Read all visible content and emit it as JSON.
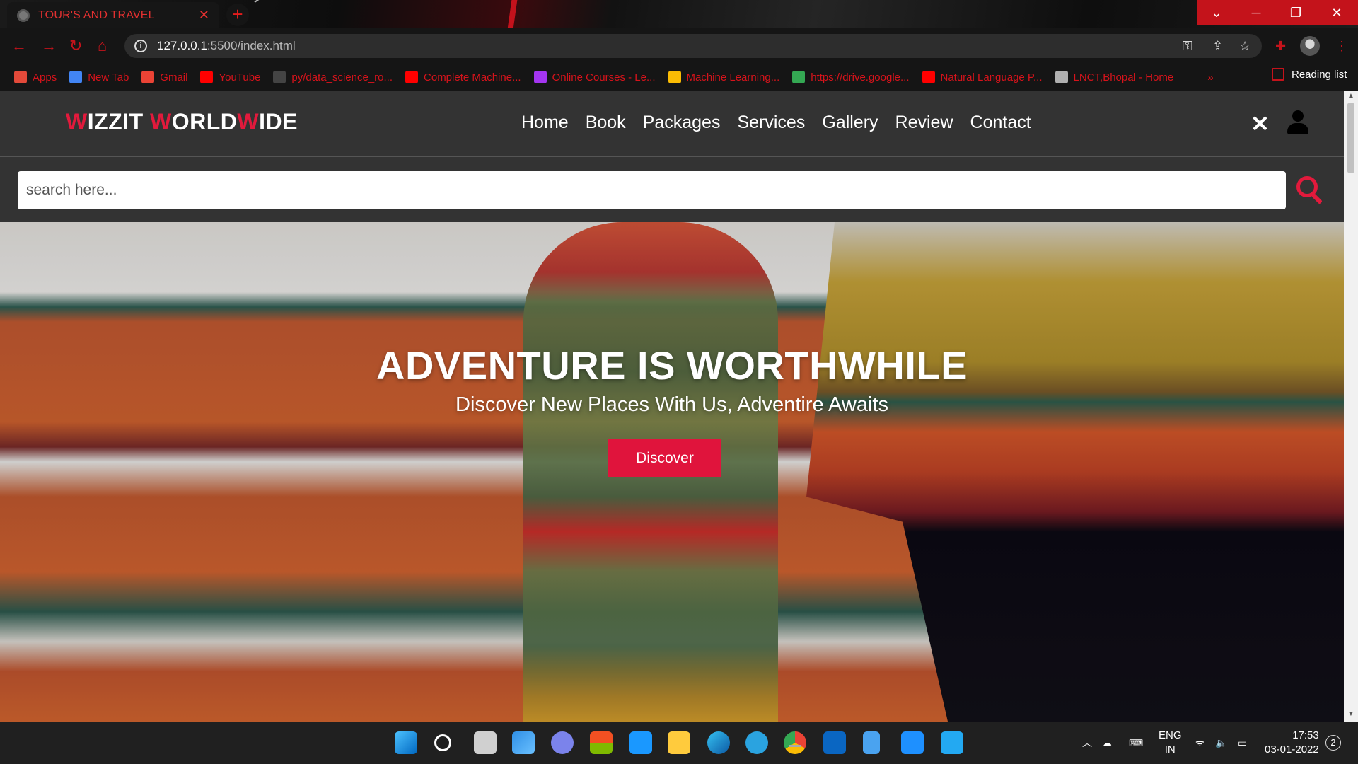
{
  "browser": {
    "tab_title": "TOUR'S AND TRAVEL",
    "tab_close": "✕",
    "new_tab": "+",
    "url_host": "127.0.0.1",
    "url_path": ":5500/index.html",
    "bookmarks": [
      {
        "label": "Apps",
        "icon": "apps-grid-icon",
        "color": "#e34a3a"
      },
      {
        "label": "New Tab",
        "icon": "google-icon",
        "color": "#4285f4"
      },
      {
        "label": "Gmail",
        "icon": "gmail-icon",
        "color": "#ea4335"
      },
      {
        "label": "YouTube",
        "icon": "youtube-icon",
        "color": "#ff0000"
      },
      {
        "label": "py/data_science_ro...",
        "icon": "github-icon",
        "color": "#444444"
      },
      {
        "label": "Complete Machine...",
        "icon": "youtube-icon",
        "color": "#ff0000"
      },
      {
        "label": "Online Courses - Le...",
        "icon": "udemy-icon",
        "color": "#a435f0"
      },
      {
        "label": "Machine Learning...",
        "icon": "drive-icon",
        "color": "#fbbc04"
      },
      {
        "label": "https://drive.google...",
        "icon": "drive-icon",
        "color": "#34a853"
      },
      {
        "label": "Natural Language P...",
        "icon": "youtube-icon",
        "color": "#ff0000"
      },
      {
        "label": "LNCT,Bhopal - Home",
        "icon": "lnct-icon",
        "color": "#b0b0b0"
      }
    ],
    "more_bookmarks": "»",
    "reading_list": "Reading list"
  },
  "site": {
    "logo": {
      "w1": "W",
      "rest1": "IZZIT ",
      "w2": "W",
      "rest2": "ORLD",
      "w3": "W",
      "rest3": "IDE"
    },
    "nav": [
      "Home",
      "Book",
      "Packages",
      "Services",
      "Gallery",
      "Review",
      "Contact"
    ],
    "close_glyph": "✕",
    "search_placeholder": "search here...",
    "hero_title": "ADVENTURE IS WORTHWHILE",
    "hero_subtitle": "Discover New Places With Us, Adventire Awaits",
    "cta_label": "Discover",
    "accent": "#e21a3c"
  },
  "taskbar": {
    "apps": [
      "start-icon",
      "search-icon",
      "task-view-icon",
      "widgets-icon",
      "teams-chat-icon",
      "store-icon",
      "prime-video-icon",
      "file-explorer-icon",
      "edge-icon",
      "telegram-icon",
      "chrome-icon",
      "linkedin-icon",
      "notepad-icon",
      "mail-icon",
      "vscode-icon"
    ],
    "lang_top": "ENG",
    "lang_bottom": "IN",
    "time": "17:53",
    "date": "03-01-2022",
    "notifications": "2"
  }
}
